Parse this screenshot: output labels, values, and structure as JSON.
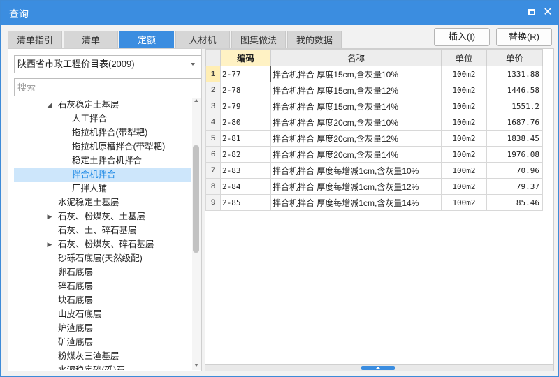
{
  "window": {
    "title": "查询"
  },
  "tabs": [
    {
      "label": "清单指引"
    },
    {
      "label": "清单"
    },
    {
      "label": "定额",
      "active": true
    },
    {
      "label": "人材机"
    },
    {
      "label": "图集做法"
    },
    {
      "label": "我的数据"
    }
  ],
  "actions": {
    "insert_label": "插入(I)",
    "replace_label": "替换(R)"
  },
  "left": {
    "dropdown_value": "陕西省市政工程价目表(2009)",
    "search_placeholder": "搜索",
    "tree": [
      {
        "label": "石灰稳定土基层",
        "level": 1,
        "arrow": "expanded"
      },
      {
        "label": "人工拌合",
        "level": 2
      },
      {
        "label": "拖拉机拌合(带犁耙)",
        "level": 2
      },
      {
        "label": "拖拉机原槽拌合(带犁耙)",
        "level": 2
      },
      {
        "label": "稳定土拌合机拌合",
        "level": 2
      },
      {
        "label": "拌合机拌合",
        "level": 2,
        "selected": true
      },
      {
        "label": "厂拌人铺",
        "level": 2
      },
      {
        "label": "水泥稳定土基层",
        "level": 1
      },
      {
        "label": "石灰、粉煤灰、土基层",
        "level": 1,
        "arrow": "collapsed"
      },
      {
        "label": "石灰、土、碎石基层",
        "level": 1
      },
      {
        "label": "石灰、粉煤灰、碎石基层",
        "level": 1,
        "arrow": "collapsed"
      },
      {
        "label": "砂砾石底层(天然级配)",
        "level": 1
      },
      {
        "label": "卵石底层",
        "level": 1
      },
      {
        "label": "碎石底层",
        "level": 1
      },
      {
        "label": "块石底层",
        "level": 1
      },
      {
        "label": "山皮石底层",
        "level": 1
      },
      {
        "label": "炉渣底层",
        "level": 1
      },
      {
        "label": "矿渣底层",
        "level": 1
      },
      {
        "label": "粉煤灰三渣基层",
        "level": 1
      },
      {
        "label": "水泥稳定碎(砾)石",
        "level": 1
      }
    ]
  },
  "grid": {
    "headers": {
      "code": "编码",
      "name": "名称",
      "unit": "单位",
      "price": "单价"
    },
    "rows": [
      {
        "num": "1",
        "code": "2-77",
        "name": "拌合机拌合 厚度15cm,含灰量10%",
        "unit": "100m2",
        "price": "1331.88"
      },
      {
        "num": "2",
        "code": "2-78",
        "name": "拌合机拌合 厚度15cm,含灰量12%",
        "unit": "100m2",
        "price": "1446.58"
      },
      {
        "num": "3",
        "code": "2-79",
        "name": "拌合机拌合 厚度15cm,含灰量14%",
        "unit": "100m2",
        "price": "1551.2"
      },
      {
        "num": "4",
        "code": "2-80",
        "name": "拌合机拌合 厚度20cm,含灰量10%",
        "unit": "100m2",
        "price": "1687.76"
      },
      {
        "num": "5",
        "code": "2-81",
        "name": "拌合机拌合 厚度20cm,含灰量12%",
        "unit": "100m2",
        "price": "1838.45"
      },
      {
        "num": "6",
        "code": "2-82",
        "name": "拌合机拌合 厚度20cm,含灰量14%",
        "unit": "100m2",
        "price": "1976.08"
      },
      {
        "num": "7",
        "code": "2-83",
        "name": "拌合机拌合 厚度每增减1cm,含灰量10%",
        "unit": "100m2",
        "price": "70.96"
      },
      {
        "num": "8",
        "code": "2-84",
        "name": "拌合机拌合 厚度每增减1cm,含灰量12%",
        "unit": "100m2",
        "price": "79.37"
      },
      {
        "num": "9",
        "code": "2-85",
        "name": "拌合机拌合 厚度每增减1cm,含灰量14%",
        "unit": "100m2",
        "price": "85.46"
      }
    ]
  },
  "colors": {
    "accent": "#3b8de0",
    "selected_bg": "#cde6fb",
    "header_highlight": "#fff2c4"
  },
  "icons": {
    "maximize": "maximize-icon",
    "close": "close-icon"
  }
}
